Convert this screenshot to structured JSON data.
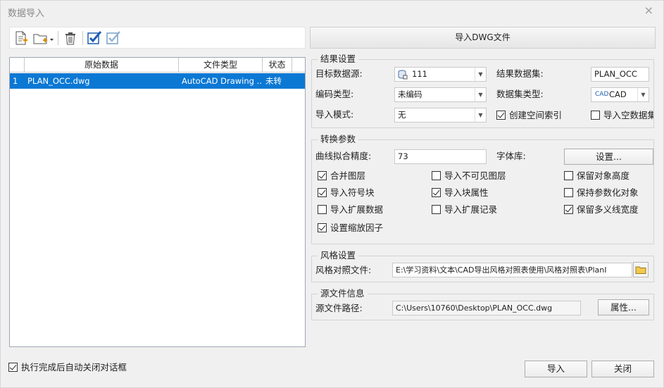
{
  "window": {
    "title": "数据导入",
    "close": "×"
  },
  "toolbar": {
    "icons": [
      "new-file-icon",
      "open-folder-icon",
      "delete-icon",
      "select-all-icon",
      "select-inverse-icon"
    ]
  },
  "import_dwg_button": "导入DWG文件",
  "grid": {
    "columns": [
      "原始数据",
      "文件类型",
      "状态"
    ],
    "rows": [
      {
        "index": "1",
        "source": "PLAN_OCC.dwg",
        "type": "AutoCAD Drawing ...",
        "status": "未转"
      }
    ]
  },
  "result": {
    "title": "结果设置",
    "target_ds_label": "目标数据源:",
    "target_ds_value": "111",
    "encode_label": "编码类型:",
    "encode_value": "未编码",
    "mode_label": "导入模式:",
    "mode_value": "无",
    "result_dataset_label": "结果数据集:",
    "result_dataset_value": "PLAN_OCC",
    "dataset_type_label": "数据集类型:",
    "dataset_type_icon_text": "CAD",
    "dataset_type_value": "CAD",
    "create_index_label": "创建空间索引",
    "import_empty_label": "导入空数据集"
  },
  "convert": {
    "title": "转换参数",
    "curve_label": "曲线拟合精度:",
    "curve_value": "73",
    "font_label": "字体库:",
    "settings_button": "设置...",
    "checks": [
      {
        "label": "合并图层",
        "checked": true
      },
      {
        "label": "导入不可见图层",
        "checked": false
      },
      {
        "label": "保留对象高度",
        "checked": false
      },
      {
        "label": "导入符号块",
        "checked": true
      },
      {
        "label": "导入块属性",
        "checked": true
      },
      {
        "label": "保持参数化对象",
        "checked": false
      },
      {
        "label": "导入扩展数据",
        "checked": false
      },
      {
        "label": "导入扩展记录",
        "checked": false
      },
      {
        "label": "保留多义线宽度",
        "checked": true
      },
      {
        "label": "设置缩放因子",
        "checked": true
      }
    ]
  },
  "style": {
    "title": "风格设置",
    "map_label": "风格对照文件:",
    "map_value": "E:\\学习资料\\文本\\CAD导出风格对照表使用\\风格对照表\\PlanI"
  },
  "source": {
    "title": "源文件信息",
    "path_label": "源文件路径:",
    "path_value": "C:\\Users\\10760\\Desktop\\PLAN_OCC.dwg",
    "props_button": "属性..."
  },
  "footer": {
    "auto_close_label": "执行完成后自动关闭对话框",
    "auto_close_checked": true,
    "import_button": "导入",
    "close_button": "关闭"
  },
  "colors": {
    "selection": "#0b78d4",
    "accent_blue": "#1e5fb3"
  }
}
